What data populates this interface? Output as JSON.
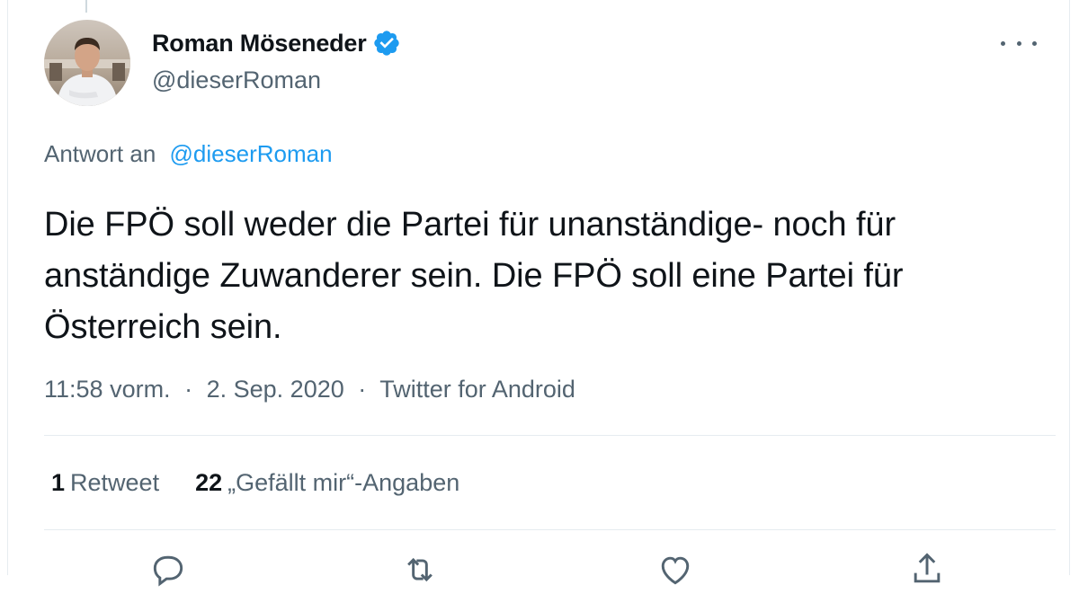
{
  "tweet": {
    "display_name": "Roman Möseneder",
    "handle": "@dieserRoman",
    "verified": true,
    "reply_prefix": "Antwort an",
    "reply_to": "@dieserRoman",
    "text": "Die FPÖ soll weder die Partei für unanständige- noch für anständige Zuwanderer sein. Die FPÖ soll eine Partei für Österreich sein.",
    "time": "11:58 vorm.",
    "date": "2. Sep. 2020",
    "source": "Twitter for Android",
    "separator": "·"
  },
  "stats": {
    "retweets_count": "1",
    "retweets_label": "Retweet",
    "likes_count": "22",
    "likes_label": "„Gefällt mir“-Angaben"
  },
  "actions": {
    "reply_icon": "comment-icon",
    "retweet_icon": "retweet-icon",
    "like_icon": "heart-icon",
    "share_icon": "share-icon"
  },
  "colors": {
    "accent": "#1d9bf0",
    "text": "#0f1419",
    "secondary": "#536471",
    "border": "#e6ecf0"
  }
}
